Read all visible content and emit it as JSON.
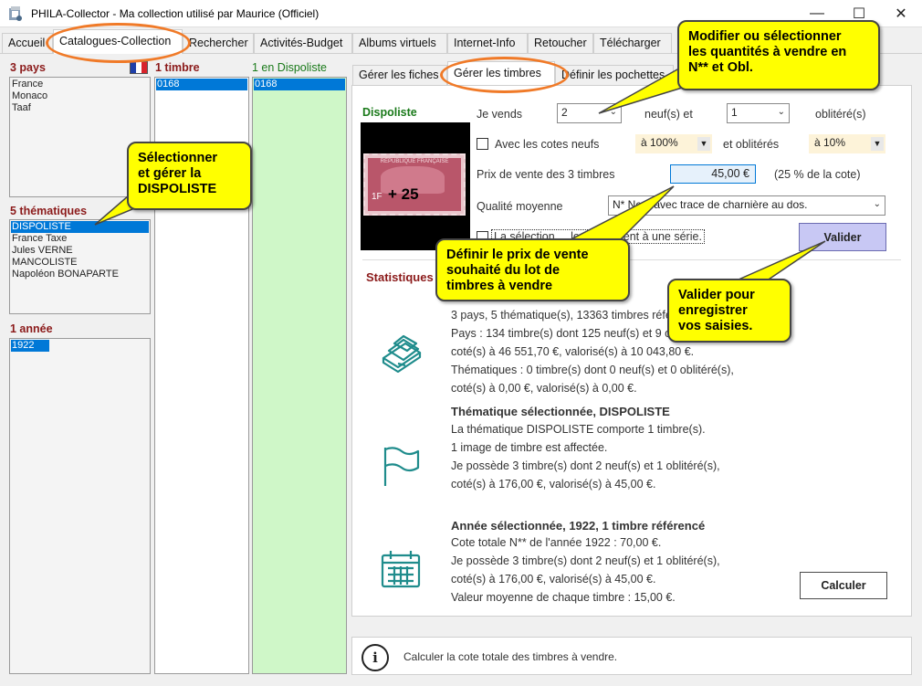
{
  "window": {
    "title": "PHILA-Collector - Ma collection utilisé par Maurice (Officiel)",
    "minimize": "—",
    "maximize": "☐",
    "close": "✕"
  },
  "tabs": [
    "Accueil",
    "Catalogues-Collection",
    "Rechercher",
    "Activités-Budget",
    "Albums virtuels",
    "Internet-Info",
    "Retoucher",
    "Télécharger"
  ],
  "left": {
    "pays_title": "3 pays",
    "pays": [
      "France",
      "Monaco",
      "Taaf"
    ],
    "them_title": "5 thématiques",
    "themes": [
      "DISPOLISTE",
      "France Taxe",
      "Jules VERNE",
      "MANCOLISTE",
      "Napoléon BONAPARTE"
    ],
    "annee_title": "1 année",
    "annees": [
      "1922"
    ],
    "timbre_title": "1 timbre",
    "timbres": [
      "0168"
    ],
    "dispo_title": "1 en Dispoliste",
    "dispo": [
      "0168"
    ]
  },
  "subtabs": [
    "Gérer les fiches",
    "Gérer les timbres",
    "Définir les pochettes"
  ],
  "form": {
    "section": "Dispoliste",
    "je_vends": "Je vends",
    "qty_neuf": "2",
    "neuf_label": "neuf(s) et",
    "qty_obl": "1",
    "obl_label": "oblitéré(s)",
    "cotes_label": "Avec les cotes neufs",
    "cote_neuf": "à 100%",
    "et_obl": "et oblitérés",
    "cote_obl": "à 10%",
    "prix_label": "Prix de vente des 3 timbres",
    "prix_value": "45,00 €",
    "prix_pct": "(25 % de la cote)",
    "qualite_label": "Qualité moyenne",
    "qualite_value": "N* Neuf avec trace de charnière au dos.",
    "serie_label": "La sélection ... les appartient à une série.",
    "valider": "Valider"
  },
  "stats": {
    "title": "Statistiques",
    "block1": [
      "3 pays, 5 thématique(s), 13363 timbres référencés",
      "Pays : 134 timbre(s) dont 125 neuf(s) et 9 oblitéré(s),",
      "coté(s) à 46 551,70 €, valorisé(s) à 10 043,80 €.",
      "Thématiques : 0 timbre(s) dont 0 neuf(s) et 0 oblitéré(s),",
      "coté(s) à 0,00 €, valorisé(s) à 0,00 €."
    ],
    "head2": "Thématique sélectionnée, DISPOLISTE",
    "block2": [
      "La thématique DISPOLISTE comporte 1 timbre(s).",
      "1 image de timbre est affectée.",
      "Je possède 3 timbre(s) dont 2 neuf(s) et 1 oblitéré(s),",
      "coté(s) à 176,00 €, valorisé(s) à 45,00 €."
    ],
    "head3": "Année sélectionnée, 1922, 1 timbre référencé",
    "block3": [
      "Cote totale N** de l'année 1922 : 70,00 €.",
      "Je possède 3 timbre(s) dont 2 neuf(s) et 1 oblitéré(s),",
      "coté(s) à 176,00 €, valorisé(s) à 45,00 €.",
      "Valeur moyenne de chaque timbre : 15,00 €."
    ],
    "calculer": "Calculer"
  },
  "status": {
    "text": "Calculer la cote totale des timbres à vendre."
  },
  "stamp": {
    "line1": "RÉPUBLIQUE FRANÇAISE",
    "surcharge": "+ 25",
    "value": "1F"
  },
  "callouts": {
    "c1": [
      "Sélectionner",
      "et gérer la",
      "DISPOLISTE"
    ],
    "c2": [
      "Modifier ou sélectionner",
      "les quantités à vendre en",
      "N** et Obl."
    ],
    "c3": [
      "Définir le prix de vente",
      "souhaité du lot de",
      "timbres à vendre"
    ],
    "c4": [
      "Valider pour",
      "enregistrer",
      "vos saisies."
    ]
  },
  "colors": {
    "accent": "#0078d7",
    "section_title": "#8b1a1a",
    "dispo_green": "#1a7a1a",
    "callout": "#ffff00",
    "oval": "#f07a28",
    "icon_teal": "#1f8c8c"
  }
}
